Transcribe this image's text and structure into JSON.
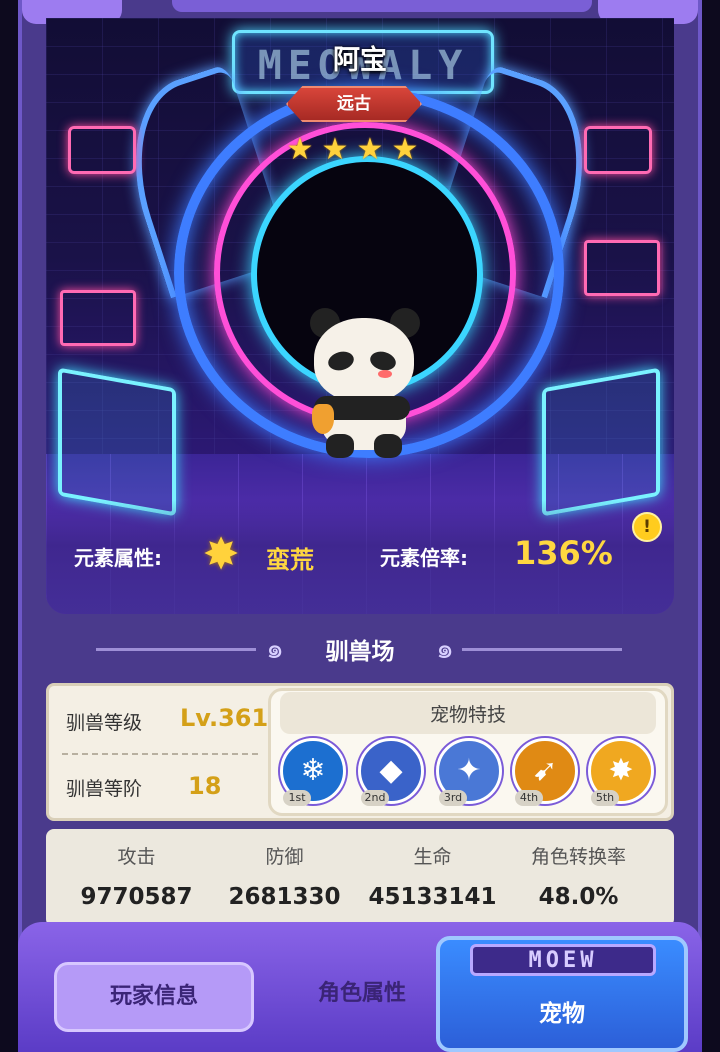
{
  "pet": {
    "name": "阿宝",
    "rarity": "远古",
    "stars": [
      "★",
      "★",
      "★",
      "★"
    ]
  },
  "neon_sign_text": "MEOWALY",
  "element": {
    "attribute_label": "元素属性:",
    "attribute_value": "蛮荒",
    "multiplier_label": "元素倍率:",
    "multiplier_value": "136%",
    "info_icon": "!"
  },
  "section": {
    "title": "驯兽场"
  },
  "taming": {
    "level_label": "驯兽等级",
    "level_value": "Lv.361",
    "rank_label": "驯兽等阶",
    "rank_value": "18"
  },
  "skills": {
    "title": "宠物特技",
    "items": [
      {
        "tag": "1st",
        "icon": "snowflake-icon",
        "glyph": "❄",
        "color": "#1c6fd0"
      },
      {
        "tag": "2nd",
        "icon": "ice-crystal-icon",
        "glyph": "◆",
        "color": "#3a63c9"
      },
      {
        "tag": "3rd",
        "icon": "crystal-cluster-icon",
        "glyph": "✦",
        "color": "#4a78d6"
      },
      {
        "tag": "4th",
        "icon": "golden-strike-icon",
        "glyph": "➹",
        "color": "#e08a14"
      },
      {
        "tag": "5th",
        "icon": "beast-roar-icon",
        "glyph": "✸",
        "color": "#f0a820"
      }
    ]
  },
  "stats": [
    {
      "label": "攻击",
      "value": "9770587"
    },
    {
      "label": "防御",
      "value": "2681330"
    },
    {
      "label": "生命",
      "value": "45133141"
    },
    {
      "label": "角色转换率",
      "value": "48.0%"
    }
  ],
  "nav": {
    "tab1": "玩家信息",
    "tab2": "角色属性",
    "tab3": "宠物",
    "badge": "MOEW"
  },
  "colors": {
    "accent_gold": "#ffd740",
    "frame_purple": "#4a3a8c",
    "active_tab_blue": "#2c5fd8"
  }
}
